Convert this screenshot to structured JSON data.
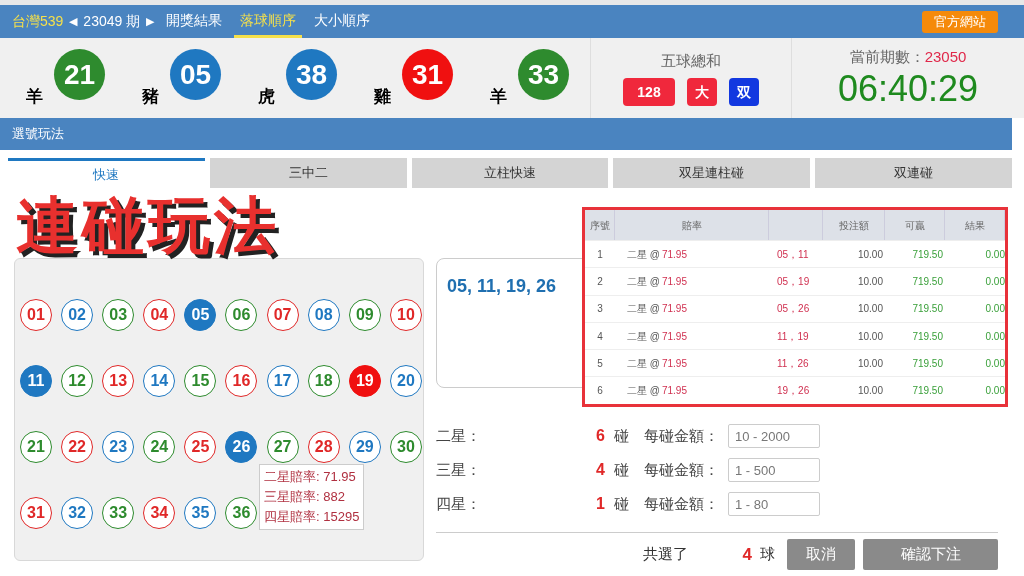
{
  "header": {
    "lottery": "台灣539",
    "prev_arrow": "◀",
    "period": "23049 期",
    "next_arrow": "▶",
    "tabs": [
      {
        "label": "開獎結果",
        "selected": false
      },
      {
        "label": "落球順序",
        "selected": true
      },
      {
        "label": "大小順序",
        "selected": false
      }
    ],
    "official_button": "官方網站"
  },
  "draw": {
    "balls": [
      {
        "number": "21",
        "zodiac": "羊",
        "color": "#2e8b2e"
      },
      {
        "number": "05",
        "zodiac": "豬",
        "color": "#1f78c1"
      },
      {
        "number": "38",
        "zodiac": "虎",
        "color": "#1f78c1"
      },
      {
        "number": "31",
        "zodiac": "雞",
        "color": "#f01010"
      },
      {
        "number": "33",
        "zodiac": "羊",
        "color": "#2e8b2e"
      }
    ],
    "sum_label": "五球總和",
    "sum_badges": [
      {
        "text": "128",
        "color": "#f0283c"
      },
      {
        "text": "大",
        "color": "#f0283c"
      },
      {
        "text": "双",
        "color": "#1238e0"
      }
    ],
    "current_label": "當前期數：",
    "current_period": "23050",
    "countdown": "06:40:29"
  },
  "section_title": "選號玩法",
  "overlay_title": "連碰玩法",
  "play_tabs": [
    {
      "label": "快速",
      "selected": true
    },
    {
      "label": "三中二",
      "selected": false
    },
    {
      "label": "立柱快速",
      "selected": false
    },
    {
      "label": "双星連柱碰",
      "selected": false
    },
    {
      "label": "双連碰",
      "selected": false
    }
  ],
  "number_balls": [
    {
      "number": "01",
      "color": "#e02828",
      "selected": false
    },
    {
      "number": "02",
      "color": "#1f78c1",
      "selected": false
    },
    {
      "number": "03",
      "color": "#2e8b2e",
      "selected": false
    },
    {
      "number": "04",
      "color": "#e02828",
      "selected": false
    },
    {
      "number": "05",
      "color": "#1f78c1",
      "selected": true
    },
    {
      "number": "06",
      "color": "#2e8b2e",
      "selected": false
    },
    {
      "number": "07",
      "color": "#e02828",
      "selected": false
    },
    {
      "number": "08",
      "color": "#1f78c1",
      "selected": false
    },
    {
      "number": "09",
      "color": "#2e8b2e",
      "selected": false
    },
    {
      "number": "10",
      "color": "#e02828",
      "selected": false
    },
    {
      "number": "11",
      "color": "#1f78c1",
      "selected": true
    },
    {
      "number": "12",
      "color": "#2e8b2e",
      "selected": false
    },
    {
      "number": "13",
      "color": "#e02828",
      "selected": false
    },
    {
      "number": "14",
      "color": "#1f78c1",
      "selected": false
    },
    {
      "number": "15",
      "color": "#2e8b2e",
      "selected": false
    },
    {
      "number": "16",
      "color": "#e02828",
      "selected": false
    },
    {
      "number": "17",
      "color": "#1f78c1",
      "selected": false
    },
    {
      "number": "18",
      "color": "#2e8b2e",
      "selected": false
    },
    {
      "number": "19",
      "color": "#f01010",
      "selected": true
    },
    {
      "number": "20",
      "color": "#1f78c1",
      "selected": false
    },
    {
      "number": "21",
      "color": "#2e8b2e",
      "selected": false
    },
    {
      "number": "22",
      "color": "#e02828",
      "selected": false
    },
    {
      "number": "23",
      "color": "#1f78c1",
      "selected": false
    },
    {
      "number": "24",
      "color": "#2e8b2e",
      "selected": false
    },
    {
      "number": "25",
      "color": "#e02828",
      "selected": false
    },
    {
      "number": "26",
      "color": "#1f78c1",
      "selected": true
    },
    {
      "number": "27",
      "color": "#2e8b2e",
      "selected": false
    },
    {
      "number": "28",
      "color": "#e02828",
      "selected": false
    },
    {
      "number": "29",
      "color": "#1f78c1",
      "selected": false
    },
    {
      "number": "30",
      "color": "#2e8b2e",
      "selected": false
    },
    {
      "number": "31",
      "color": "#e02828",
      "selected": false
    },
    {
      "number": "32",
      "color": "#1f78c1",
      "selected": false
    },
    {
      "number": "33",
      "color": "#2e8b2e",
      "selected": false
    },
    {
      "number": "34",
      "color": "#e02828",
      "selected": false
    },
    {
      "number": "35",
      "color": "#1f78c1",
      "selected": false
    },
    {
      "number": "36",
      "color": "#2e8b2e",
      "selected": false
    }
  ],
  "odds_tooltip": [
    "二星賠率: 71.95",
    "三星賠率: 882",
    "四星賠率: 15295"
  ],
  "selected_numbers": "05, 11, 19, 26",
  "bet_table": {
    "columns": [
      "序號",
      "賠率",
      "",
      "投注額",
      "可贏",
      "結果"
    ],
    "rows": [
      [
        "1",
        "二星 @",
        "71.95",
        "05，11",
        "10.00",
        "719.50",
        "0.00"
      ],
      [
        "2",
        "二星 @",
        "71.95",
        "05，19",
        "10.00",
        "719.50",
        "0.00"
      ],
      [
        "3",
        "二星 @",
        "71.95",
        "05，26",
        "10.00",
        "719.50",
        "0.00"
      ],
      [
        "4",
        "二星 @",
        "71.95",
        "11，19",
        "10.00",
        "719.50",
        "0.00"
      ],
      [
        "5",
        "二星 @",
        "71.95",
        "11，26",
        "10.00",
        "719.50",
        "0.00"
      ],
      [
        "6",
        "二星 @",
        "71.95",
        "19，26",
        "10.00",
        "719.50",
        "0.00"
      ]
    ]
  },
  "bet_rows": [
    {
      "label": "二星：",
      "count": "6",
      "unit": "碰",
      "amount_label": "每碰金額：",
      "placeholder": "10 - 2000"
    },
    {
      "label": "三星：",
      "count": "4",
      "unit": "碰",
      "amount_label": "每碰金額：",
      "placeholder": "1 - 500"
    },
    {
      "label": "四星：",
      "count": "1",
      "unit": "碰",
      "amount_label": "每碰金額：",
      "placeholder": "1 - 80"
    }
  ],
  "footer": {
    "total_label": "共選了",
    "total_count": "4",
    "total_unit": "球",
    "cancel": "取消",
    "confirm": "確認下注"
  }
}
